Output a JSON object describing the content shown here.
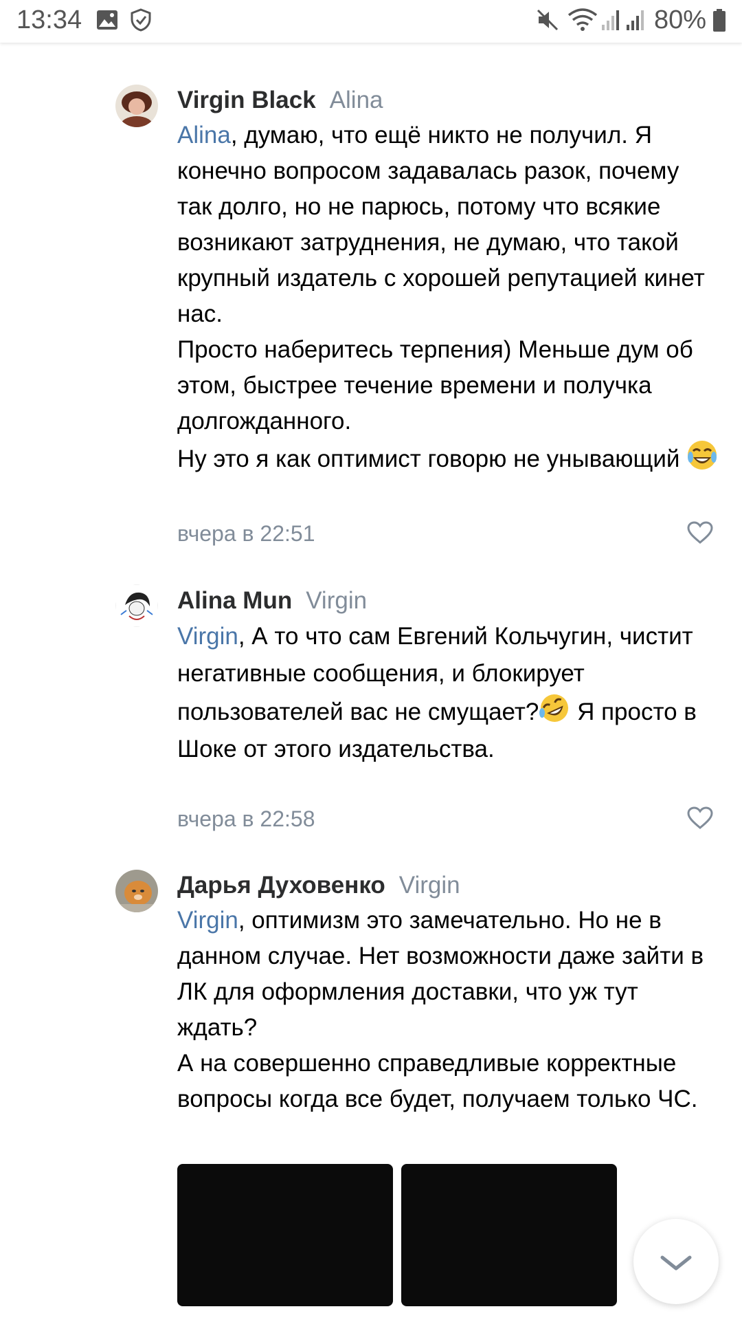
{
  "status": {
    "time": "13:34",
    "battery": "80%"
  },
  "comments": [
    {
      "author": "Virgin Black",
      "reply_to": "Alina",
      "mention": "Alina",
      "lines": [
        ", думаю, что ещё никто не получил. Я конечно вопросом задавалась разок, почему так долго, но не парюсь, потому что всякие возникают затруднения, не думаю, что такой крупный издатель с хорошей репутацией кинет нас.",
        "Просто наберитесь терпения) Меньше дум об этом, быстрее течение времени и получка долгожданного.",
        "Ну это я как оптимист говорю не унывающий"
      ],
      "time": "вчера в 22:51"
    },
    {
      "author": "Alina Mun",
      "reply_to": "Virgin",
      "mention": "Virgin",
      "text_a": ", А то что сам Евгений Кольчугин, чистит негативные сообщения, и блокирует пользователей вас не смущает?",
      "text_b": " Я просто в Шоке от этого издательства.",
      "time": "вчера в 22:58"
    },
    {
      "author": "Дарья Духовенко",
      "reply_to": "Virgin",
      "mention": "Virgin",
      "lines": [
        ", оптимизм это замечательно. Но не в данном случае. Нет возможности даже зайти в ЛК для оформления доставки, что уж тут ждать?",
        "А на совершенно справедливые корректные вопросы  когда все будет, получаем только ЧС."
      ]
    }
  ],
  "icons": {
    "status_left": [
      "gallery-icon",
      "shield-icon"
    ],
    "status_right": [
      "mute-icon",
      "wifi-icon",
      "signal-icon",
      "signal-icon-2",
      "battery-icon"
    ],
    "emoji_1": "tears-of-joy-emoji",
    "emoji_2": "rolling-laughing-emoji",
    "like": "heart-outline-icon",
    "scroll": "chevron-down-icon"
  },
  "colors": {
    "mention": "#4a76a8",
    "meta": "#818c99",
    "author": "#2c2d2e"
  }
}
